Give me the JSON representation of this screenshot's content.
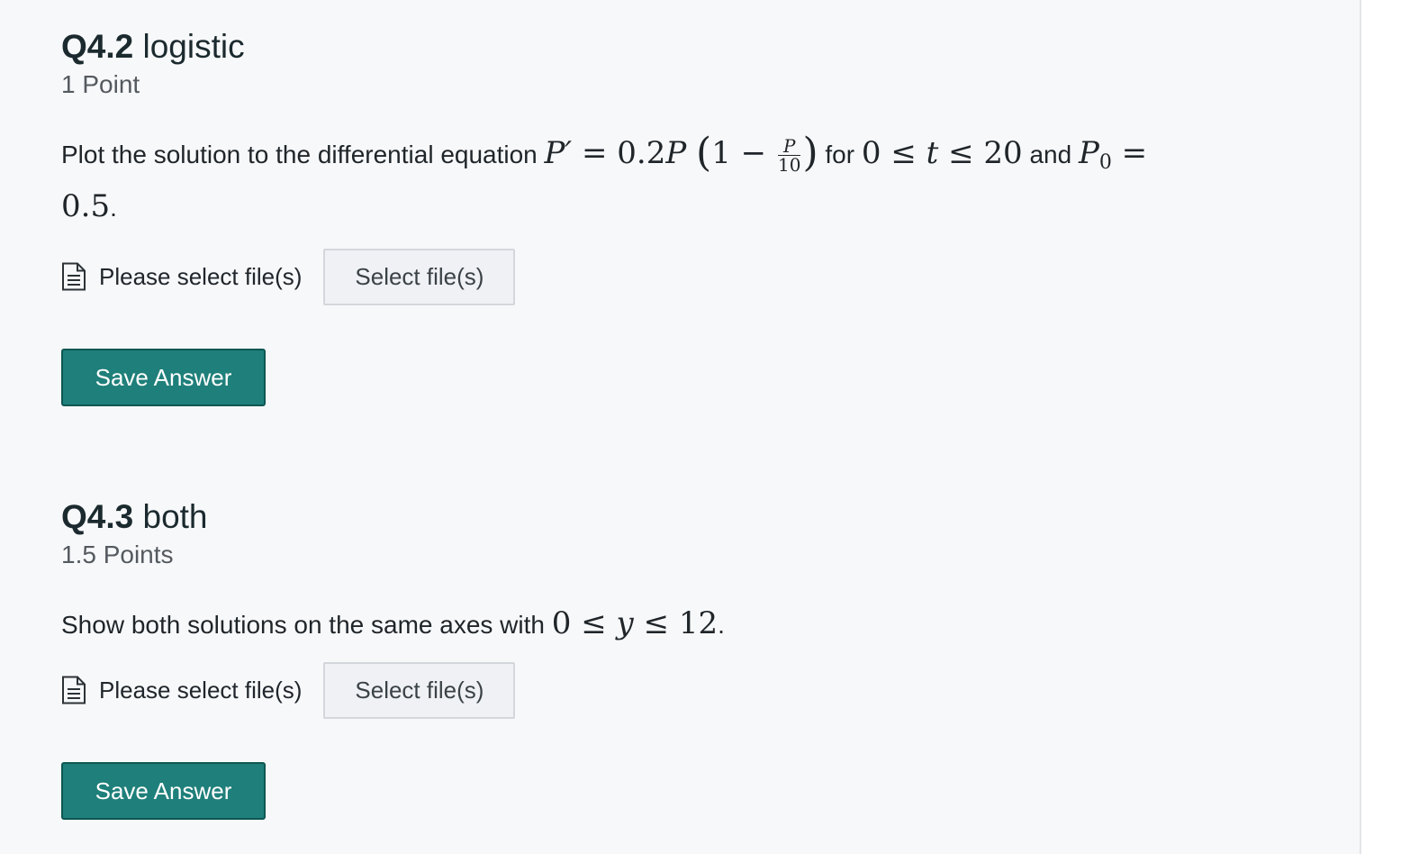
{
  "questions": [
    {
      "number": "Q4.2",
      "title": "logistic",
      "points": "1 Point",
      "prompt_intro": "Plot the solution to the differential equation",
      "equation": {
        "lhs": "P′",
        "eq": "=",
        "coef": "0.2",
        "var": "P",
        "one": "1",
        "minus": "−",
        "frac_num": "P",
        "frac_den": "10"
      },
      "connector_for": "for",
      "range": {
        "low": "0",
        "le1": "≤",
        "var": "t",
        "le2": "≤",
        "high": "20"
      },
      "connector_and": "and",
      "initial": {
        "var": "P",
        "sub": "0",
        "eq": "=",
        "value": "0.5"
      },
      "period": ".",
      "file_status": "Please select file(s)",
      "select_label": "Select file(s)",
      "save_label": "Save Answer"
    },
    {
      "number": "Q4.3",
      "title": "both",
      "points": "1.5 Points",
      "prompt_intro": "Show both solutions on the same axes with",
      "range": {
        "low": "0",
        "le1": "≤",
        "var": "y",
        "le2": "≤",
        "high": "12"
      },
      "period": ".",
      "file_status": "Please select file(s)",
      "select_label": "Select file(s)",
      "save_label": "Save Answer"
    }
  ],
  "icons": {
    "file": "document-icon"
  },
  "colors": {
    "accent": "#1f7f7a",
    "background": "#f7f8fa"
  }
}
